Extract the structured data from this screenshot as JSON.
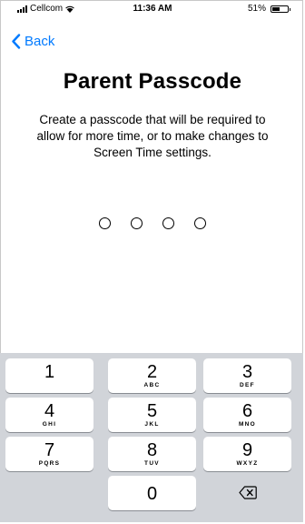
{
  "status_bar": {
    "carrier": "Cellcom",
    "time": "11:36 AM",
    "battery_percent": "51%",
    "battery_level": 0.51
  },
  "nav": {
    "back_label": "Back",
    "accent_color": "#007aff"
  },
  "screen": {
    "title": "Parent Passcode",
    "subtitle": "Create a passcode that will be required to allow for more time, or to make changes to Screen Time settings.",
    "passcode_length": 4,
    "entered_digits": 0
  },
  "keypad": {
    "keys": [
      {
        "digit": "1",
        "letters": ""
      },
      {
        "digit": "2",
        "letters": "ABC"
      },
      {
        "digit": "3",
        "letters": "DEF"
      },
      {
        "digit": "4",
        "letters": "GHI"
      },
      {
        "digit": "5",
        "letters": "JKL"
      },
      {
        "digit": "6",
        "letters": "MNO"
      },
      {
        "digit": "7",
        "letters": "PQRS"
      },
      {
        "digit": "8",
        "letters": "TUV"
      },
      {
        "digit": "9",
        "letters": "WXYZ"
      },
      {
        "digit": "0",
        "letters": ""
      }
    ],
    "delete_icon": "backspace-icon"
  }
}
